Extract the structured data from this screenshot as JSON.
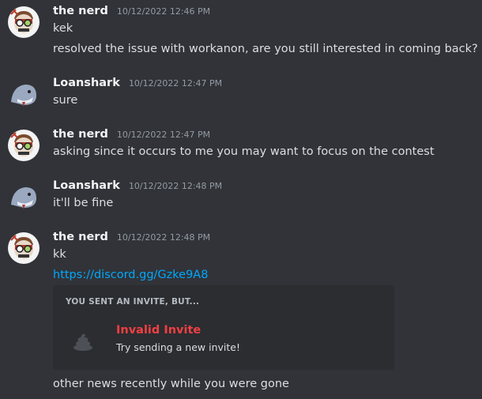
{
  "colors": {
    "background": "#313338",
    "embed_background": "#2b2d31",
    "username": "#f2f3f5",
    "timestamp": "#949ba4",
    "text": "#dbdee1",
    "link": "#00a8fc",
    "invalid": "#f23f42"
  },
  "messages": [
    {
      "author": "the nerd",
      "avatar_icon": "nerd-avatar-icon",
      "timestamp": "10/12/2022 12:46 PM",
      "lines": [
        "kek",
        "resolved the issue with workanon, are you still interested in coming back?"
      ]
    },
    {
      "author": "Loanshark",
      "avatar_icon": "shark-avatar-icon",
      "timestamp": "10/12/2022 12:47 PM",
      "lines": [
        "sure"
      ]
    },
    {
      "author": "the nerd",
      "avatar_icon": "nerd-avatar-icon",
      "timestamp": "10/12/2022 12:47 PM",
      "lines": [
        "asking since it occurs to me you may want to focus on the contest"
      ]
    },
    {
      "author": "Loanshark",
      "avatar_icon": "shark-avatar-icon",
      "timestamp": "10/12/2022 12:48 PM",
      "lines": [
        "it'll be fine"
      ]
    },
    {
      "author": "the nerd",
      "avatar_icon": "nerd-avatar-icon",
      "timestamp": "10/12/2022 12:48 PM",
      "lines": [
        "kk"
      ],
      "link": "https://discord.gg/Gzke9A8",
      "invite": {
        "header": "YOU SENT AN INVITE, BUT...",
        "icon": "poop-icon",
        "title": "Invalid Invite",
        "subtitle": "Try sending a new invite!"
      },
      "after_lines": [
        "other news recently while you were gone"
      ]
    }
  ]
}
